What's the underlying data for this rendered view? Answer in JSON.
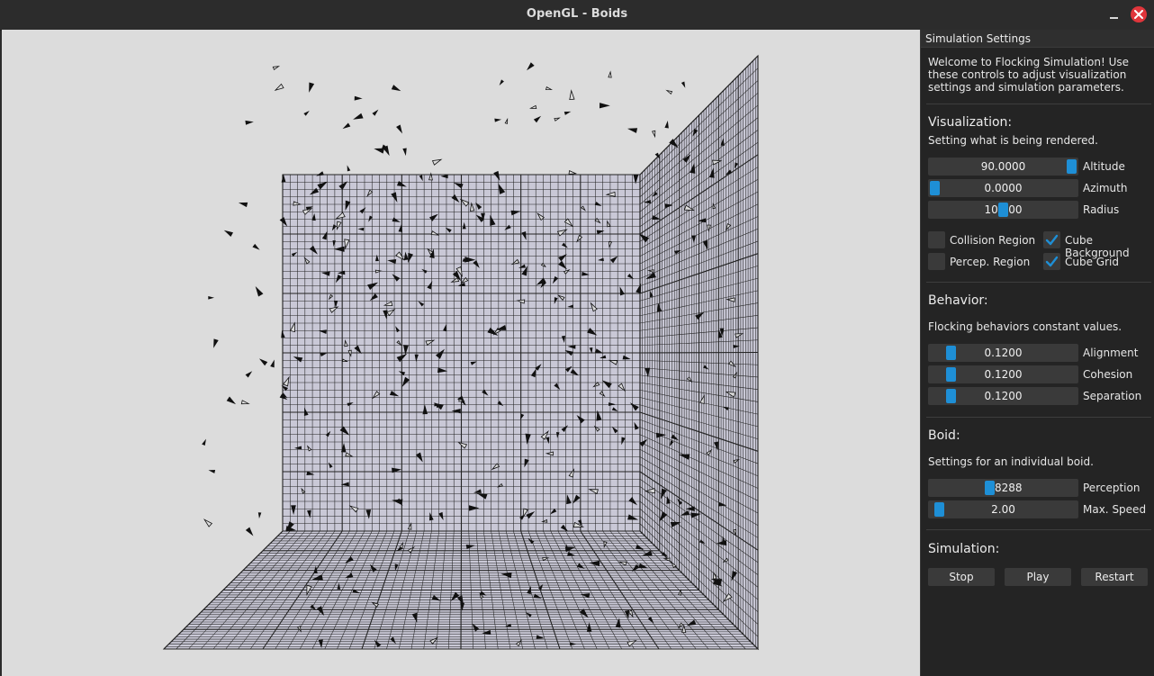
{
  "window": {
    "title": "OpenGL - Boids"
  },
  "panel": {
    "header": "Simulation Settings",
    "intro": "Welcome to Flocking Simulation! Use these controls to adjust visualization settings and simulation parameters.",
    "visualization": {
      "heading": "Visualization:",
      "desc": "Setting what is being rendered.",
      "sliders": [
        {
          "value": "90.0000",
          "label": "Altitude",
          "fraction": 1.0
        },
        {
          "value": "0.0000",
          "label": "Azimuth",
          "fraction": 0.0
        },
        {
          "value": "100.00",
          "label": "Radius",
          "fraction": 0.5
        }
      ],
      "checks": [
        {
          "label": "Collision Region",
          "checked": false
        },
        {
          "label": "Cube Background",
          "checked": true
        },
        {
          "label": "Percep. Region",
          "checked": false
        },
        {
          "label": "Cube Grid",
          "checked": true
        }
      ]
    },
    "behavior": {
      "heading": "Behavior:",
      "desc": "Flocking behaviors constant values.",
      "sliders": [
        {
          "value": "0.1200",
          "label": "Alignment",
          "fraction": 0.12
        },
        {
          "value": "0.1200",
          "label": "Cohesion",
          "fraction": 0.12
        },
        {
          "value": "0.1200",
          "label": "Separation",
          "fraction": 0.12
        }
      ]
    },
    "boid": {
      "heading": "Boid:",
      "desc": "Settings for an individual boid.",
      "sliders": [
        {
          "value": "2.8288",
          "label": "Perception",
          "fraction": 0.4
        },
        {
          "value": "2.00",
          "label": "Max. Speed",
          "fraction": 0.03
        }
      ]
    },
    "simulation": {
      "heading": "Simulation:",
      "buttons": [
        "Stop",
        "Play",
        "Restart"
      ]
    }
  },
  "colors": {
    "accent": "#1e8fd6",
    "close": "#e0353b",
    "viewport_bg": "#dcdcdc",
    "cube_fill": "#c9c8d6",
    "grid_line": "#222222"
  }
}
